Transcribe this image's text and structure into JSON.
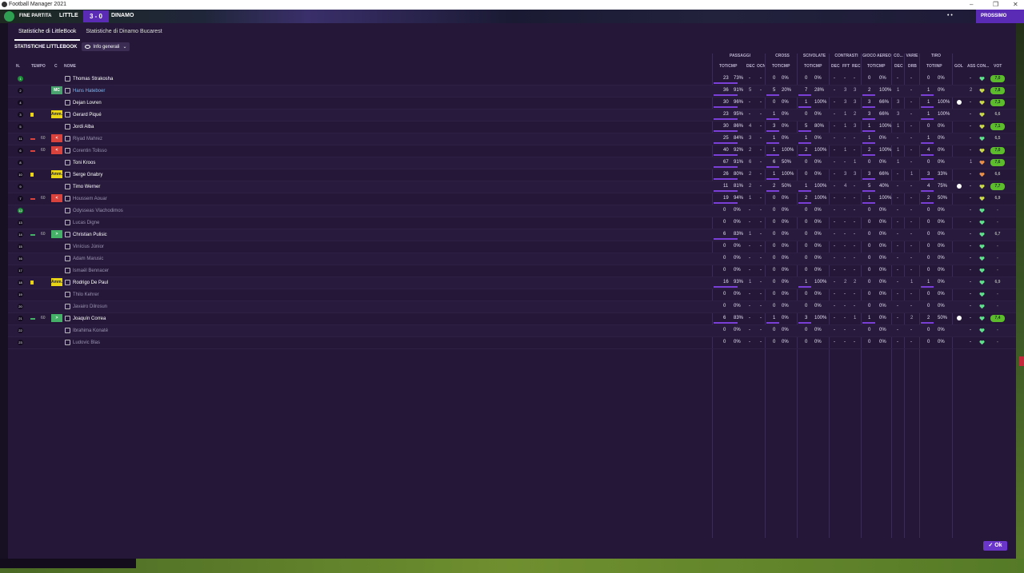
{
  "window": {
    "title": "Football Manager 2021",
    "controls": [
      "–",
      "❐",
      "✕"
    ]
  },
  "match": {
    "status": "FINE PARTITA",
    "team_home": "LITTLE",
    "score": "3 - 0",
    "team_away": "DINAMO",
    "separator": "• •",
    "continue_label": "PROSSIMO"
  },
  "tabs": [
    "Statistiche di LittleBook",
    "Statistiche di Dinamo Bucarest"
  ],
  "subheader": {
    "title": "STATISTICHE LITTLEBOOK",
    "view_label": "Info generali"
  },
  "group_headers": [
    "PASSAGGI",
    "CROSS",
    "SCIVOLATE",
    "CONTRASTI",
    "GIOCO AEREO",
    "CO...",
    "VARIE",
    "TIRO"
  ],
  "columns": {
    "num": "N.",
    "tempo": "TEMPO",
    "c": "C",
    "nome": "NOME",
    "pass_totcmp": "TOT/CMP",
    "pass_dec": "DEC",
    "pass_ocn": "OCN",
    "cross_totcmp": "TOT/CMP",
    "sciv_totcmp": "TOT/CMP",
    "contr_dec": "DEC",
    "contr_fft": "FFT",
    "contr_rec": "REC",
    "aereo_totcmp": "TOT/CMP",
    "co_dec": "DEC",
    "varie_drb": "DRB",
    "tiro_totinp": "TOT/INP",
    "gol": "GOL",
    "ass": "ASS",
    "con": "CON...",
    "vot": "VOT"
  },
  "players": [
    {
      "num": "1",
      "gk": true,
      "tempo": "",
      "tmp_icon": "",
      "pos": "",
      "pos_color": "",
      "name": "Thomas Strakosha",
      "style": "",
      "pass": "23",
      "pass_pct": "73%",
      "dec": "-",
      "ocn": "-",
      "cross": "0",
      "cross_pct": "0%",
      "sciv": "0",
      "sciv_pct": "0%",
      "cdec": "-",
      "fft": "-",
      "rec": "-",
      "aer": "0",
      "aer_pct": "0%",
      "codec": "-",
      "drb": "-",
      "tiro": "0",
      "tiro_pct": "0%",
      "gol": "",
      "ass": "-",
      "heart": "#5fe08a",
      "vote": "7,0",
      "vote_color": "#5cbc2c"
    },
    {
      "num": "2",
      "gk": false,
      "tempo": "",
      "tmp_icon": "",
      "pos": "MC",
      "pos_color": "#4aa36e",
      "name": "Hans Hateboer",
      "style": "hl",
      "pass": "36",
      "pass_pct": "91%",
      "dec": "5",
      "ocn": "-",
      "cross": "5",
      "cross_pct": "20%",
      "sciv": "7",
      "sciv_pct": "28%",
      "cdec": "-",
      "fft": "3",
      "rec": "3",
      "aer": "2",
      "aer_pct": "100%",
      "codec": "1",
      "drb": "-",
      "tiro": "1",
      "tiro_pct": "0%",
      "gol": "",
      "ass": "2",
      "heart": "#c8d84a",
      "vote": "7,8",
      "vote_color": "#5cbc2c"
    },
    {
      "num": "4",
      "gk": false,
      "tempo": "",
      "tmp_icon": "",
      "pos": "",
      "pos_color": "",
      "name": "Dejan Lovren",
      "style": "",
      "pass": "30",
      "pass_pct": "96%",
      "dec": "-",
      "ocn": "-",
      "cross": "0",
      "cross_pct": "0%",
      "sciv": "1",
      "sciv_pct": "100%",
      "cdec": "-",
      "fft": "3",
      "rec": "3",
      "aer": "3",
      "aer_pct": "66%",
      "codec": "3",
      "drb": "-",
      "tiro": "1",
      "tiro_pct": "100%",
      "gol": "ball",
      "ass": "-",
      "heart": "#c8d84a",
      "vote": "7,3",
      "vote_color": "#5cbc2c"
    },
    {
      "num": "3",
      "gk": false,
      "tempo": "",
      "tmp_icon": "yellow",
      "pos": "Amm.",
      "pos_color": "#e9d417",
      "name": "Gerard Piqué",
      "style": "",
      "pass": "23",
      "pass_pct": "95%",
      "dec": "-",
      "ocn": "-",
      "cross": "1",
      "cross_pct": "0%",
      "sciv": "0",
      "sciv_pct": "0%",
      "cdec": "-",
      "fft": "1",
      "rec": "2",
      "aer": "3",
      "aer_pct": "66%",
      "codec": "3",
      "drb": "-",
      "tiro": "1",
      "tiro_pct": "100%",
      "gol": "",
      "ass": "-",
      "heart": "#c8d84a",
      "vote": "6,6",
      "vote_color": "none"
    },
    {
      "num": "5",
      "gk": false,
      "tempo": "",
      "tmp_icon": "",
      "pos": "",
      "pos_color": "",
      "name": "Jordi Alba",
      "style": "",
      "pass": "30",
      "pass_pct": "86%",
      "dec": "4",
      "ocn": "-",
      "cross": "3",
      "cross_pct": "0%",
      "sciv": "5",
      "sciv_pct": "80%",
      "cdec": "-",
      "fft": "1",
      "rec": "3",
      "aer": "1",
      "aer_pct": "100%",
      "codec": "1",
      "drb": "-",
      "tiro": "0",
      "tiro_pct": "0%",
      "gol": "",
      "ass": "-",
      "heart": "#c8d84a",
      "vote": "7,1",
      "vote_color": "#5cbc2c"
    },
    {
      "num": "11",
      "gk": false,
      "tempo": "60",
      "tmp_icon": "out",
      "pos": "<",
      "pos_color": "#d9433e",
      "name": "Riyad Mahrez",
      "style": "dim",
      "pass": "25",
      "pass_pct": "84%",
      "dec": "3",
      "ocn": "-",
      "cross": "1",
      "cross_pct": "0%",
      "sciv": "1",
      "sciv_pct": "0%",
      "cdec": "-",
      "fft": "-",
      "rec": "-",
      "aer": "1",
      "aer_pct": "0%",
      "codec": "-",
      "drb": "-",
      "tiro": "1",
      "tiro_pct": "0%",
      "gol": "",
      "ass": "-",
      "heart": "#5fe08a",
      "vote": "6,5",
      "vote_color": "none"
    },
    {
      "num": "6",
      "gk": false,
      "tempo": "60",
      "tmp_icon": "out",
      "pos": "<",
      "pos_color": "#d9433e",
      "name": "Corentin Tolisso",
      "style": "dim",
      "pass": "40",
      "pass_pct": "92%",
      "dec": "2",
      "ocn": "-",
      "cross": "1",
      "cross_pct": "100%",
      "sciv": "2",
      "sciv_pct": "100%",
      "cdec": "-",
      "fft": "1",
      "rec": "-",
      "aer": "2",
      "aer_pct": "100%",
      "codec": "1",
      "drb": "-",
      "tiro": "4",
      "tiro_pct": "0%",
      "gol": "",
      "ass": "-",
      "heart": "#c8d84a",
      "vote": "7,0",
      "vote_color": "#5cbc2c"
    },
    {
      "num": "8",
      "gk": false,
      "tempo": "",
      "tmp_icon": "",
      "pos": "",
      "pos_color": "",
      "name": "Toni Kroos",
      "style": "",
      "pass": "67",
      "pass_pct": "91%",
      "dec": "6",
      "ocn": "-",
      "cross": "6",
      "cross_pct": "50%",
      "sciv": "0",
      "sciv_pct": "0%",
      "cdec": "-",
      "fft": "-",
      "rec": "1",
      "aer": "0",
      "aer_pct": "0%",
      "codec": "1",
      "drb": "-",
      "tiro": "0",
      "tiro_pct": "0%",
      "gol": "",
      "ass": "1",
      "heart": "#e8904a",
      "vote": "7,6",
      "vote_color": "#5cbc2c"
    },
    {
      "num": "10",
      "gk": false,
      "tempo": "",
      "tmp_icon": "yellow",
      "pos": "Amm.",
      "pos_color": "#e9d417",
      "name": "Serge Gnabry",
      "style": "",
      "pass": "26",
      "pass_pct": "80%",
      "dec": "2",
      "ocn": "-",
      "cross": "1",
      "cross_pct": "100%",
      "sciv": "0",
      "sciv_pct": "0%",
      "cdec": "-",
      "fft": "3",
      "rec": "3",
      "aer": "3",
      "aer_pct": "66%",
      "codec": "-",
      "drb": "1",
      "tiro": "3",
      "tiro_pct": "33%",
      "gol": "",
      "ass": "-",
      "heart": "#e8904a",
      "vote": "6,6",
      "vote_color": "none"
    },
    {
      "num": "9",
      "gk": false,
      "tempo": "",
      "tmp_icon": "",
      "pos": "",
      "pos_color": "",
      "name": "Timo Werner",
      "style": "",
      "pass": "11",
      "pass_pct": "81%",
      "dec": "2",
      "ocn": "-",
      "cross": "2",
      "cross_pct": "50%",
      "sciv": "1",
      "sciv_pct": "100%",
      "cdec": "-",
      "fft": "4",
      "rec": "-",
      "aer": "5",
      "aer_pct": "40%",
      "codec": "-",
      "drb": "-",
      "tiro": "4",
      "tiro_pct": "75%",
      "gol": "ball",
      "ass": "-",
      "heart": "#c8d84a",
      "vote": "7,7",
      "vote_color": "#5cbc2c"
    },
    {
      "num": "7",
      "gk": false,
      "tempo": "60",
      "tmp_icon": "out",
      "pos": "<",
      "pos_color": "#d9433e",
      "name": "Houssem Aouar",
      "style": "dim",
      "pass": "19",
      "pass_pct": "94%",
      "dec": "1",
      "ocn": "-",
      "cross": "0",
      "cross_pct": "0%",
      "sciv": "2",
      "sciv_pct": "100%",
      "cdec": "-",
      "fft": "-",
      "rec": "-",
      "aer": "1",
      "aer_pct": "100%",
      "codec": "-",
      "drb": "-",
      "tiro": "2",
      "tiro_pct": "50%",
      "gol": "",
      "ass": "-",
      "heart": "#c8d84a",
      "vote": "6,9",
      "vote_color": "none"
    },
    {
      "num": "12",
      "gk": true,
      "tempo": "",
      "tmp_icon": "",
      "pos": "",
      "pos_color": "",
      "name": "Odysseas Vlachodimos",
      "style": "dim",
      "pass": "0",
      "pass_pct": "0%",
      "dec": "-",
      "ocn": "-",
      "cross": "0",
      "cross_pct": "0%",
      "sciv": "0",
      "sciv_pct": "0%",
      "cdec": "-",
      "fft": "-",
      "rec": "-",
      "aer": "0",
      "aer_pct": "0%",
      "codec": "-",
      "drb": "-",
      "tiro": "0",
      "tiro_pct": "0%",
      "gol": "",
      "ass": "-",
      "heart": "#5fe08a",
      "vote": "-",
      "vote_color": "none"
    },
    {
      "num": "13",
      "gk": false,
      "tempo": "",
      "tmp_icon": "",
      "pos": "",
      "pos_color": "",
      "name": "Lucas Digne",
      "style": "dim",
      "pass": "0",
      "pass_pct": "0%",
      "dec": "-",
      "ocn": "-",
      "cross": "0",
      "cross_pct": "0%",
      "sciv": "0",
      "sciv_pct": "0%",
      "cdec": "-",
      "fft": "-",
      "rec": "-",
      "aer": "0",
      "aer_pct": "0%",
      "codec": "-",
      "drb": "-",
      "tiro": "0",
      "tiro_pct": "0%",
      "gol": "",
      "ass": "-",
      "heart": "#5fe08a",
      "vote": "-",
      "vote_color": "none"
    },
    {
      "num": "14",
      "gk": false,
      "tempo": "60",
      "tmp_icon": "in",
      "pos": ">",
      "pos_color": "#45b067",
      "name": "Christian Pulisic",
      "style": "",
      "pass": "6",
      "pass_pct": "83%",
      "dec": "1",
      "ocn": "-",
      "cross": "0",
      "cross_pct": "0%",
      "sciv": "0",
      "sciv_pct": "0%",
      "cdec": "-",
      "fft": "-",
      "rec": "-",
      "aer": "0",
      "aer_pct": "0%",
      "codec": "-",
      "drb": "-",
      "tiro": "0",
      "tiro_pct": "0%",
      "gol": "",
      "ass": "-",
      "heart": "#5fe08a",
      "vote": "6,7",
      "vote_color": "none"
    },
    {
      "num": "15",
      "gk": false,
      "tempo": "",
      "tmp_icon": "",
      "pos": "",
      "pos_color": "",
      "name": "Vinícius Júnior",
      "style": "dim",
      "pass": "0",
      "pass_pct": "0%",
      "dec": "-",
      "ocn": "-",
      "cross": "0",
      "cross_pct": "0%",
      "sciv": "0",
      "sciv_pct": "0%",
      "cdec": "-",
      "fft": "-",
      "rec": "-",
      "aer": "0",
      "aer_pct": "0%",
      "codec": "-",
      "drb": "-",
      "tiro": "0",
      "tiro_pct": "0%",
      "gol": "",
      "ass": "-",
      "heart": "#5fe08a",
      "vote": "-",
      "vote_color": "none"
    },
    {
      "num": "16",
      "gk": false,
      "tempo": "",
      "tmp_icon": "",
      "pos": "",
      "pos_color": "",
      "name": "Adam Marusic",
      "style": "dim",
      "pass": "0",
      "pass_pct": "0%",
      "dec": "-",
      "ocn": "-",
      "cross": "0",
      "cross_pct": "0%",
      "sciv": "0",
      "sciv_pct": "0%",
      "cdec": "-",
      "fft": "-",
      "rec": "-",
      "aer": "0",
      "aer_pct": "0%",
      "codec": "-",
      "drb": "-",
      "tiro": "0",
      "tiro_pct": "0%",
      "gol": "",
      "ass": "-",
      "heart": "#5fe08a",
      "vote": "-",
      "vote_color": "none"
    },
    {
      "num": "17",
      "gk": false,
      "tempo": "",
      "tmp_icon": "",
      "pos": "",
      "pos_color": "",
      "name": "Ismaël Bennacer",
      "style": "dim",
      "pass": "0",
      "pass_pct": "0%",
      "dec": "-",
      "ocn": "-",
      "cross": "0",
      "cross_pct": "0%",
      "sciv": "0",
      "sciv_pct": "0%",
      "cdec": "-",
      "fft": "-",
      "rec": "-",
      "aer": "0",
      "aer_pct": "0%",
      "codec": "-",
      "drb": "-",
      "tiro": "0",
      "tiro_pct": "0%",
      "gol": "",
      "ass": "-",
      "heart": "#5fe08a",
      "vote": "-",
      "vote_color": "none"
    },
    {
      "num": "18",
      "gk": false,
      "tempo": "",
      "tmp_icon": "yellow",
      "pos": "Amm.",
      "pos_color": "#e9d417",
      "name": "Rodrigo De Paul",
      "style": "",
      "pass": "16",
      "pass_pct": "93%",
      "dec": "1",
      "ocn": "-",
      "cross": "0",
      "cross_pct": "0%",
      "sciv": "1",
      "sciv_pct": "100%",
      "cdec": "-",
      "fft": "2",
      "rec": "2",
      "aer": "0",
      "aer_pct": "0%",
      "codec": "-",
      "drb": "1",
      "tiro": "1",
      "tiro_pct": "0%",
      "gol": "",
      "ass": "-",
      "heart": "#5fe08a",
      "vote": "6,9",
      "vote_color": "none"
    },
    {
      "num": "19",
      "gk": false,
      "tempo": "",
      "tmp_icon": "",
      "pos": "",
      "pos_color": "",
      "name": "Thilo Kehrer",
      "style": "dim",
      "pass": "0",
      "pass_pct": "0%",
      "dec": "-",
      "ocn": "-",
      "cross": "0",
      "cross_pct": "0%",
      "sciv": "0",
      "sciv_pct": "0%",
      "cdec": "-",
      "fft": "-",
      "rec": "-",
      "aer": "0",
      "aer_pct": "0%",
      "codec": "-",
      "drb": "-",
      "tiro": "0",
      "tiro_pct": "0%",
      "gol": "",
      "ass": "-",
      "heart": "#5fe08a",
      "vote": "-",
      "vote_color": "none"
    },
    {
      "num": "20",
      "gk": false,
      "tempo": "",
      "tmp_icon": "",
      "pos": "",
      "pos_color": "",
      "name": "Javairo Dilrosun",
      "style": "dim",
      "pass": "0",
      "pass_pct": "0%",
      "dec": "-",
      "ocn": "-",
      "cross": "0",
      "cross_pct": "0%",
      "sciv": "0",
      "sciv_pct": "0%",
      "cdec": "-",
      "fft": "-",
      "rec": "-",
      "aer": "0",
      "aer_pct": "0%",
      "codec": "-",
      "drb": "-",
      "tiro": "0",
      "tiro_pct": "0%",
      "gol": "",
      "ass": "-",
      "heart": "#5fe08a",
      "vote": "-",
      "vote_color": "none"
    },
    {
      "num": "21",
      "gk": false,
      "tempo": "60",
      "tmp_icon": "in",
      "pos": ">",
      "pos_color": "#45b067",
      "name": "Joaquín Correa",
      "style": "",
      "pass": "6",
      "pass_pct": "83%",
      "dec": "-",
      "ocn": "-",
      "cross": "1",
      "cross_pct": "0%",
      "sciv": "3",
      "sciv_pct": "100%",
      "cdec": "-",
      "fft": "-",
      "rec": "1",
      "aer": "1",
      "aer_pct": "0%",
      "codec": "-",
      "drb": "2",
      "tiro": "2",
      "tiro_pct": "50%",
      "gol": "ball",
      "ass": "-",
      "heart": "#5fe08a",
      "vote": "7,4",
      "vote_color": "#5cbc2c"
    },
    {
      "num": "22",
      "gk": false,
      "tempo": "",
      "tmp_icon": "",
      "pos": "",
      "pos_color": "",
      "name": "Ibrahima Konaté",
      "style": "dim",
      "pass": "0",
      "pass_pct": "0%",
      "dec": "-",
      "ocn": "-",
      "cross": "0",
      "cross_pct": "0%",
      "sciv": "0",
      "sciv_pct": "0%",
      "cdec": "-",
      "fft": "-",
      "rec": "-",
      "aer": "0",
      "aer_pct": "0%",
      "codec": "-",
      "drb": "-",
      "tiro": "0",
      "tiro_pct": "0%",
      "gol": "",
      "ass": "-",
      "heart": "#5fe08a",
      "vote": "-",
      "vote_color": "none"
    },
    {
      "num": "23",
      "gk": false,
      "tempo": "",
      "tmp_icon": "",
      "pos": "",
      "pos_color": "",
      "name": "Ludovic Blas",
      "style": "dim",
      "pass": "0",
      "pass_pct": "0%",
      "dec": "-",
      "ocn": "-",
      "cross": "0",
      "cross_pct": "0%",
      "sciv": "0",
      "sciv_pct": "0%",
      "cdec": "-",
      "fft": "-",
      "rec": "-",
      "aer": "0",
      "aer_pct": "0%",
      "codec": "-",
      "drb": "-",
      "tiro": "0",
      "tiro_pct": "0%",
      "gol": "",
      "ass": "-",
      "heart": "#5fe08a",
      "vote": "-",
      "vote_color": "none"
    }
  ],
  "ok_button": {
    "label": "✓ Ok"
  }
}
